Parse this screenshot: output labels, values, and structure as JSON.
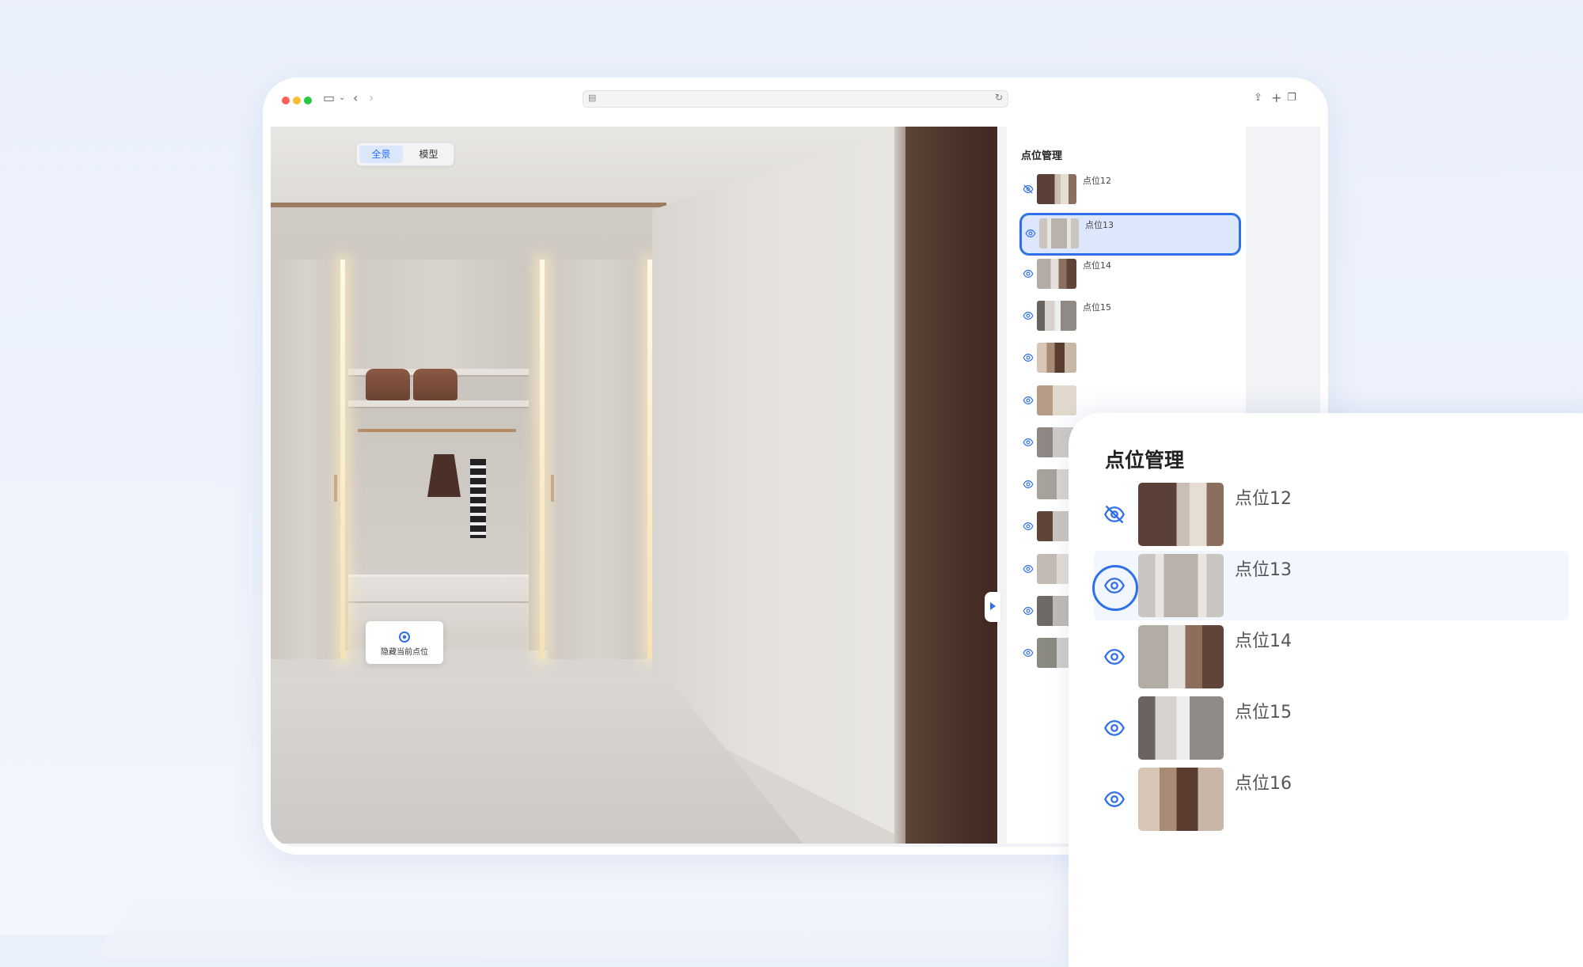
{
  "viewer": {
    "tabs": [
      {
        "label": "全景",
        "active": true
      },
      {
        "label": "模型",
        "active": false
      }
    ],
    "hide_button_label": "隐藏当前点位"
  },
  "panel": {
    "title": "点位管理",
    "items": [
      {
        "label": "点位12",
        "visible": false,
        "selected": false
      },
      {
        "label": "点位13",
        "visible": true,
        "selected": true
      },
      {
        "label": "点位14",
        "visible": true,
        "selected": false
      },
      {
        "label": "点位15",
        "visible": true,
        "selected": false
      },
      {
        "label": "",
        "visible": true,
        "selected": false
      },
      {
        "label": "",
        "visible": true,
        "selected": false
      },
      {
        "label": "",
        "visible": true,
        "selected": false
      },
      {
        "label": "",
        "visible": true,
        "selected": false
      },
      {
        "label": "",
        "visible": true,
        "selected": false
      },
      {
        "label": "",
        "visible": true,
        "selected": false
      },
      {
        "label": "",
        "visible": true,
        "selected": false
      },
      {
        "label": "",
        "visible": true,
        "selected": false
      }
    ]
  },
  "zoom": {
    "title": "点位管理",
    "items": [
      {
        "label": "点位12",
        "visible": false,
        "selected": false
      },
      {
        "label": "点位13",
        "visible": true,
        "selected": true
      },
      {
        "label": "点位14",
        "visible": true,
        "selected": false
      },
      {
        "label": "点位15",
        "visible": true,
        "selected": false
      },
      {
        "label": "点位16",
        "visible": true,
        "selected": false
      }
    ]
  },
  "colors": {
    "accent": "#2f6fea",
    "selected_bg": "#dde7fb"
  },
  "icons": {
    "visible": "eye-icon",
    "hidden": "eye-off-icon"
  }
}
